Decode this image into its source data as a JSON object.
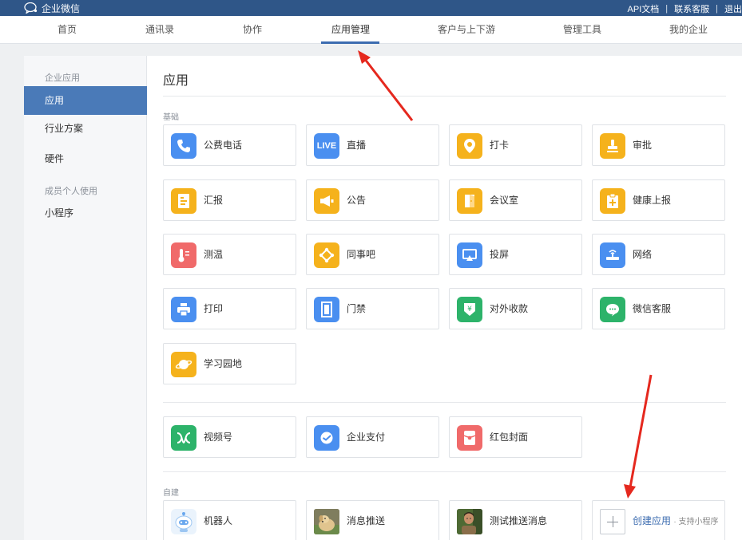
{
  "topbar": {
    "brand": "企业微信",
    "links": [
      "API文档",
      "联系客服",
      "退出"
    ]
  },
  "nav": {
    "items": [
      "首页",
      "通讯录",
      "协作",
      "应用管理",
      "客户与上下游",
      "管理工具",
      "我的企业"
    ],
    "active": "应用管理"
  },
  "sidebar": {
    "group1": "企业应用",
    "items1": [
      "应用",
      "行业方案",
      "硬件"
    ],
    "group2": "成员个人使用",
    "items2": [
      "小程序"
    ],
    "active": "应用"
  },
  "main": {
    "title": "应用",
    "basic_label": "基础",
    "basic_apps": [
      {
        "label": "公费电话",
        "icon": "phone-icon",
        "color": "#4a8ff0"
      },
      {
        "label": "直播",
        "icon": "live-icon",
        "color": "#4a8ff0"
      },
      {
        "label": "打卡",
        "icon": "location-pin-icon",
        "color": "#f5b21c"
      },
      {
        "label": "审批",
        "icon": "stamp-icon",
        "color": "#f5b21c"
      },
      {
        "label": "汇报",
        "icon": "report-icon",
        "color": "#f5b21c"
      },
      {
        "label": "公告",
        "icon": "megaphone-icon",
        "color": "#f5b21c"
      },
      {
        "label": "会议室",
        "icon": "door-icon",
        "color": "#f5b21c"
      },
      {
        "label": "健康上报",
        "icon": "health-clipboard-icon",
        "color": "#f5b21c"
      },
      {
        "label": "测温",
        "icon": "thermometer-icon",
        "color": "#f06a6a"
      },
      {
        "label": "同事吧",
        "icon": "colleague-network-icon",
        "color": "#f5b21c"
      },
      {
        "label": "投屏",
        "icon": "screen-cast-icon",
        "color": "#4a8ff0"
      },
      {
        "label": "网络",
        "icon": "wifi-router-icon",
        "color": "#4a8ff0"
      },
      {
        "label": "打印",
        "icon": "printer-icon",
        "color": "#4a8ff0"
      },
      {
        "label": "门禁",
        "icon": "access-door-icon",
        "color": "#4a8ff0"
      },
      {
        "label": "对外收款",
        "icon": "yuan-shield-icon",
        "color": "#2db36a"
      },
      {
        "label": "微信客服",
        "icon": "chat-bubble-icon",
        "color": "#2db36a"
      },
      {
        "label": "学习园地",
        "icon": "planet-icon",
        "color": "#f5b21c"
      }
    ],
    "extra_apps": [
      {
        "label": "视频号",
        "icon": "channels-icon",
        "color": "#2db36a"
      },
      {
        "label": "企业支付",
        "icon": "payment-icon",
        "color": "#4a8ff0"
      },
      {
        "label": "红包封面",
        "icon": "red-envelope-icon",
        "color": "#f06a6a"
      }
    ],
    "custom_label": "自建",
    "custom_apps": [
      {
        "label": "机器人",
        "icon": "robot-icon"
      },
      {
        "label": "消息推送",
        "icon": "dog-photo-icon"
      },
      {
        "label": "测试推送消息",
        "icon": "person-photo-icon"
      }
    ],
    "create": {
      "label": "创建应用",
      "sub": "· 支持小程序"
    }
  }
}
